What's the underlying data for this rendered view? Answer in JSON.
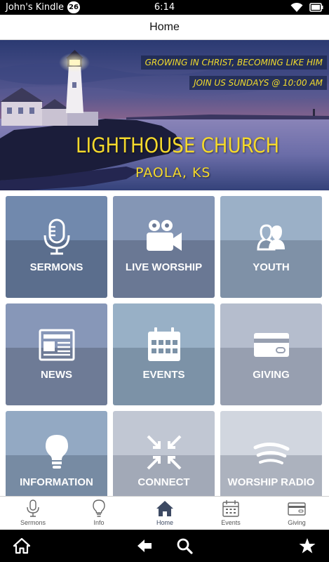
{
  "status_bar": {
    "device_name": "John's Kindle",
    "notification_count": "26",
    "time": "6:14"
  },
  "header": {
    "title": "Home"
  },
  "banner": {
    "tagline_1": "GROWING IN CHRIST, BECOMING LIKE HIM",
    "tagline_2": "JOIN US SUNDAYS @ 10:00 AM",
    "church_name": "LIGHTHOUSE CHURCH",
    "location": "PAOLA, KS",
    "tagline_color": "#f2dc2c"
  },
  "tiles": [
    {
      "label": "SERMONS",
      "icon": "microphone-icon"
    },
    {
      "label": "LIVE WORSHIP",
      "icon": "video-camera-icon"
    },
    {
      "label": "YOUTH",
      "icon": "people-icon"
    },
    {
      "label": "NEWS",
      "icon": "newspaper-icon"
    },
    {
      "label": "EVENTS",
      "icon": "calendar-icon"
    },
    {
      "label": "GIVING",
      "icon": "credit-card-icon"
    },
    {
      "label": "INFORMATION",
      "icon": "lightbulb-icon"
    },
    {
      "label": "CONNECT",
      "icon": "arrows-inward-icon"
    },
    {
      "label": "WORSHIP RADIO",
      "icon": "spotify-icon"
    }
  ],
  "tab_bar": {
    "tabs": [
      {
        "label": "Sermons",
        "icon": "microphone-icon"
      },
      {
        "label": "Info",
        "icon": "lightbulb-icon"
      },
      {
        "label": "Home",
        "icon": "home-icon",
        "active": true
      },
      {
        "label": "Events",
        "icon": "calendar-icon"
      },
      {
        "label": "Giving",
        "icon": "credit-card-icon"
      }
    ]
  },
  "system_nav": {
    "buttons": [
      "home-icon",
      "back-arrow-icon",
      "search-icon",
      "star-icon"
    ]
  }
}
